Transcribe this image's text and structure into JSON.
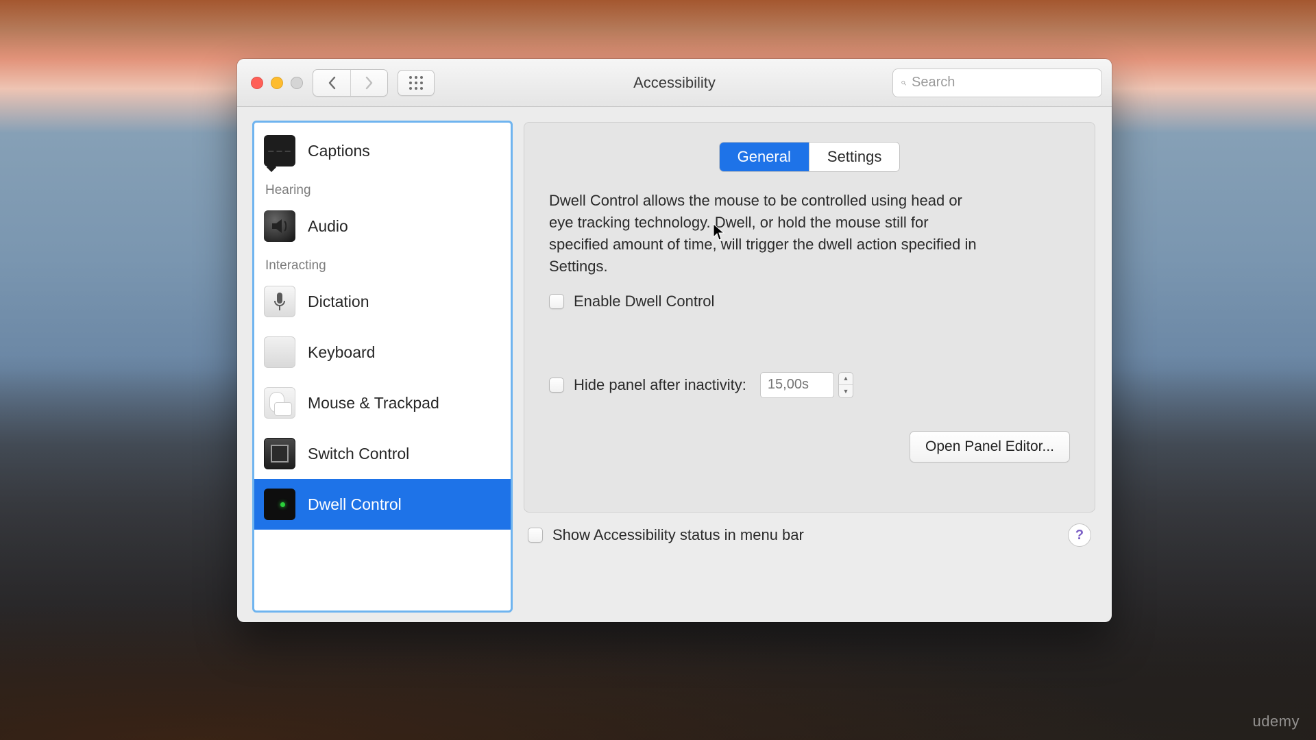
{
  "window": {
    "title": "Accessibility",
    "search_placeholder": "Search"
  },
  "sidebar": {
    "groups": [
      {
        "label": "",
        "items": [
          {
            "id": "captions",
            "label": "Captions"
          }
        ]
      },
      {
        "label": "Hearing",
        "items": [
          {
            "id": "audio",
            "label": "Audio"
          }
        ]
      },
      {
        "label": "Interacting",
        "items": [
          {
            "id": "dictation",
            "label": "Dictation"
          },
          {
            "id": "keyboard",
            "label": "Keyboard"
          },
          {
            "id": "mouse",
            "label": "Mouse & Trackpad"
          },
          {
            "id": "switch",
            "label": "Switch Control"
          },
          {
            "id": "dwell",
            "label": "Dwell Control",
            "selected": true
          }
        ]
      }
    ]
  },
  "tabs": {
    "general": "General",
    "settings": "Settings",
    "active": "general"
  },
  "main": {
    "description": "Dwell Control allows the mouse to be controlled using head or eye tracking technology. Dwell, or hold the mouse still for specified amount of time, will trigger the dwell action specified in Settings.",
    "enable_label": "Enable Dwell Control",
    "enable_checked": false,
    "hide_label": "Hide panel after inactivity:",
    "hide_checked": false,
    "hide_value": "15,00s",
    "open_panel_button": "Open Panel Editor..."
  },
  "footer": {
    "status_label": "Show Accessibility status in menu bar",
    "status_checked": false
  },
  "watermark": "udemy"
}
